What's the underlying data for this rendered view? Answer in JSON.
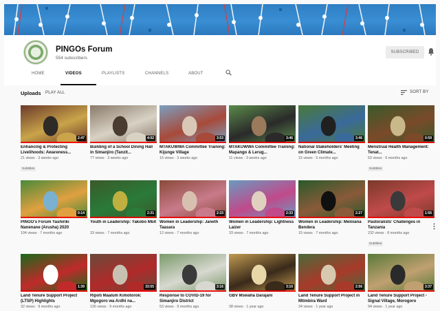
{
  "channel": {
    "name": "PINGOs Forum",
    "subscribers": "554 subscribers",
    "subscribe_label": "SUBSCRIBED"
  },
  "tabs": [
    {
      "label": "HOME"
    },
    {
      "label": "VIDEOS"
    },
    {
      "label": "PLAYLISTS"
    },
    {
      "label": "CHANNELS"
    },
    {
      "label": "ABOUT"
    }
  ],
  "uploads": {
    "title": "Uploads",
    "play_all": "PLAY ALL",
    "sort_by": "SORT BY"
  },
  "videos": [
    {
      "title": "Enhancing & Protecting Livelihoods: Awareness...",
      "meta": "21 views · 3 weeks ago",
      "duration": "2:47",
      "badge": "Subtitles",
      "thumb_colors": [
        "#6b3a2a",
        "#c9a44a",
        "#2e2a26"
      ]
    },
    {
      "title": "Building of a School Dining Hall in Simanjiro (Tanzit...",
      "meta": "77 views · 3 weeks ago",
      "duration": "4:02",
      "badge": "",
      "thumb_colors": [
        "#8a7a6a",
        "#d8d2c4",
        "#4a3c30"
      ]
    },
    {
      "title": "MTAKUWWA Committee Training: Kijunge Village",
      "meta": "15 views · 3 weeks ago",
      "duration": "3:53",
      "badge": "",
      "thumb_colors": [
        "#7a9fc0",
        "#a84a3a",
        "#d9c8b6"
      ]
    },
    {
      "title": "MTAKUWWA Committee Training: Mapango & Lerug...",
      "meta": "11 views · 3 weeks ago",
      "duration": "3:46",
      "badge": "",
      "thumb_colors": [
        "#5b8a4a",
        "#2a2a2a",
        "#9a7a5a"
      ]
    },
    {
      "title": "National Stakeholders' Meeting on Green Climate...",
      "meta": "15 views · 5 months ago",
      "duration": "3:46",
      "badge": "",
      "thumb_colors": [
        "#4a7a3a",
        "#3a6a9a",
        "#202020"
      ]
    },
    {
      "title": "Menstrual Health Management: Tenat...",
      "meta": "53 views · 6 months ago",
      "duration": "0:59",
      "badge": "Subtitles",
      "thumb_colors": [
        "#3a5a2a",
        "#7a4a2a",
        "#c8b88a"
      ]
    },
    {
      "title": "PINGO's Forum Yashiriki Nanenane (Arusha) 2020",
      "meta": "104 views · 7 months ago",
      "duration": "0:14",
      "badge": "",
      "thumb_colors": [
        "#4a8a3a",
        "#e0a040",
        "#7ab0d0"
      ]
    },
    {
      "title": "Youth in Leadership: Yakobo Mbit",
      "meta": "33 views · 7 months ago",
      "duration": "2:31",
      "badge": "",
      "thumb_colors": [
        "#3a5a2a",
        "#2a7a3a",
        "#c0b040"
      ]
    },
    {
      "title": "Women in Leadership: Janeth Taasara",
      "meta": "12 views · 7 months ago",
      "duration": "2:33",
      "badge": "",
      "thumb_colors": [
        "#8a4a3a",
        "#c87a8a",
        "#d8c0b0"
      ]
    },
    {
      "title": "Women in Leadership: Lightness Laizer",
      "meta": "33 views · 7 months ago",
      "duration": "2:33",
      "badge": "",
      "thumb_colors": [
        "#6a9ac0",
        "#c04a8a",
        "#e0d0c0"
      ]
    },
    {
      "title": "Women in Leadership: Meloiana Bendera",
      "meta": "15 views · 7 months ago",
      "duration": "2:27",
      "badge": "",
      "thumb_colors": [
        "#2a5a2a",
        "#8a5a3a",
        "#101010"
      ]
    },
    {
      "title": "Pastoralists' Challenges in Tanzania",
      "meta": "232 views · 8 months ago",
      "duration": "1:56",
      "badge": "Subtitles",
      "thumb_colors": [
        "#7a3a2a",
        "#c04a4a",
        "#3a3a3a"
      ]
    },
    {
      "title": "Land Tenure Support Project (LTSP) Highlights",
      "meta": "32 views · 9 months ago",
      "duration": "1:39",
      "badge": "",
      "thumb_colors": [
        "#1a6a1a",
        "#c02a2a",
        "#ffffff"
      ]
    },
    {
      "title": "Ripoti Maalum Kimotorok: Mgogoro wa Ardhi na...",
      "meta": "126 views · 9 months ago",
      "duration": "33:55",
      "badge": "",
      "thumb_colors": [
        "#6a4a3a",
        "#b02a2a",
        "#c8c0b0"
      ]
    },
    {
      "title": "Response to COVID-19 for Simanjiro District",
      "meta": "53 views · 9 months ago",
      "duration": "3:16",
      "badge": "",
      "thumb_colors": [
        "#7a9a6a",
        "#d8d8d0",
        "#3a3a3a"
      ]
    },
    {
      "title": "GBV Mswaha Darajani",
      "meta": "38 views · 1 year ago",
      "duration": "3:10",
      "badge": "",
      "thumb_colors": [
        "#c09a50",
        "#3a2a1a",
        "#e8d8a8"
      ]
    },
    {
      "title": "Land Tenure Support Project in Mtimbira Ward",
      "meta": "34 views · 1 year ago",
      "duration": "2:56",
      "badge": "",
      "thumb_colors": [
        "#4a6a3a",
        "#a83a2a",
        "#d8c8b0"
      ]
    },
    {
      "title": "Land Tenure Support Project - Signal Village, Morogoro",
      "meta": "94 views · 1 year ago",
      "duration": "3:37",
      "badge": "",
      "thumb_colors": [
        "#5a7a3a",
        "#c0a070",
        "#2a2a2a"
      ]
    }
  ]
}
